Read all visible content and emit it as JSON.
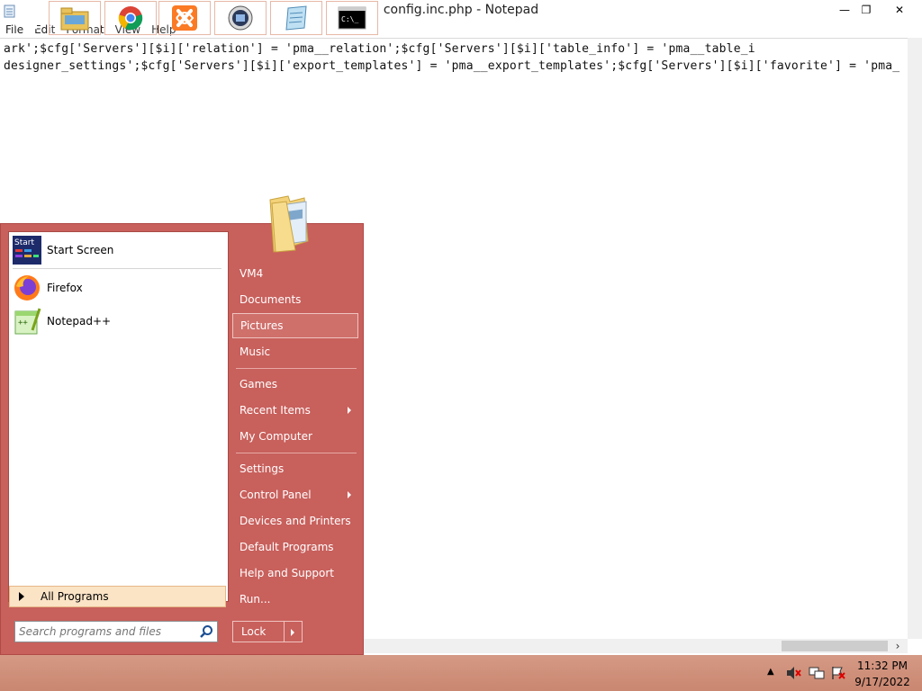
{
  "window": {
    "title": "config.inc.php - Notepad",
    "minimize_glyph": "—",
    "maximize_glyph": "❐",
    "close_glyph": "✕"
  },
  "menu": [
    "File",
    "Edit",
    "Format",
    "View",
    "Help"
  ],
  "editor": {
    "lines": [
      "ark';$cfg['Servers'][$i]['relation'] = 'pma__relation';$cfg['Servers'][$i]['table_info'] = 'pma__table_i",
      "designer_settings';$cfg['Servers'][$i]['export_templates'] = 'pma__export_templates';$cfg['Servers'][$i]['favorite'] = 'pma_"
    ]
  },
  "start_menu": {
    "pinned": [
      {
        "label": "Start Screen",
        "icon": "start-screen-icon"
      },
      {
        "label": "Firefox",
        "icon": "firefox-icon"
      },
      {
        "label": "Notepad++",
        "icon": "notepad-plus-plus-icon"
      }
    ],
    "start_tile_text": "Start",
    "all_programs": "All Programs",
    "search_placeholder": "Search programs and files",
    "right_items": [
      {
        "label": "VM4",
        "submenu": false
      },
      {
        "label": "Documents",
        "submenu": false
      },
      {
        "label": "Pictures",
        "submenu": false,
        "highlighted": true
      },
      {
        "label": "Music",
        "submenu": false
      },
      {
        "label": "Games",
        "submenu": false
      },
      {
        "label": "Recent Items",
        "submenu": true
      },
      {
        "label": "My Computer",
        "submenu": false
      },
      {
        "label": "Settings",
        "submenu": false
      },
      {
        "label": "Control Panel",
        "submenu": true
      },
      {
        "label": "Devices and Printers",
        "submenu": false
      },
      {
        "label": "Default Programs",
        "submenu": false
      },
      {
        "label": "Help and Support",
        "submenu": false
      },
      {
        "label": "Run...",
        "submenu": false
      }
    ],
    "lock_label": "Lock"
  },
  "taskbar": {
    "apps": [
      "windows-start-icon",
      "file-explorer-icon",
      "chrome-icon",
      "xampp-icon",
      "window-manager-icon",
      "notepad-icon",
      "command-prompt-icon"
    ],
    "cmd_text": "C:\\_",
    "clock_time": "11:32 PM",
    "clock_date": "9/17/2022"
  },
  "colors": {
    "start_menu_bg": "#c8605c",
    "taskbar_bg": "#d0907a",
    "all_programs_bg": "#fbe3c6"
  }
}
